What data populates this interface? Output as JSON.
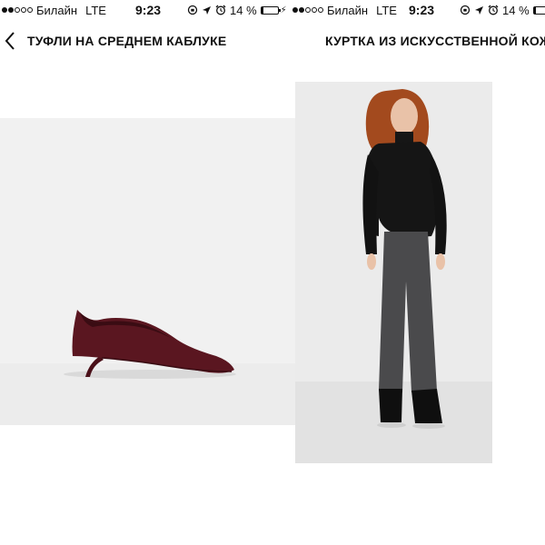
{
  "status_bar": {
    "carrier": "Билайн",
    "network": "LTE",
    "time": "9:23",
    "battery_percent": "14 %",
    "battery_level": 0.14,
    "signal_strength": 2,
    "signal_max": 5
  },
  "nav": {
    "back_icon": "chevron-left-icon"
  },
  "products": [
    {
      "title": "ТУФЛИ НА СРЕДНЕМ КАБЛУКЕ",
      "image": "burgundy-kitten-heel-pump"
    },
    {
      "title": "КУРТКА ИЗ ИСКУССТВЕННОЙ КОЖ",
      "image": "woman-black-leather-jacket-grey-trousers"
    }
  ],
  "colors": {
    "shoe": "#5a1620",
    "jacket": "#151515",
    "trousers": "#4a4a4c",
    "hair": "#a34a1e"
  }
}
